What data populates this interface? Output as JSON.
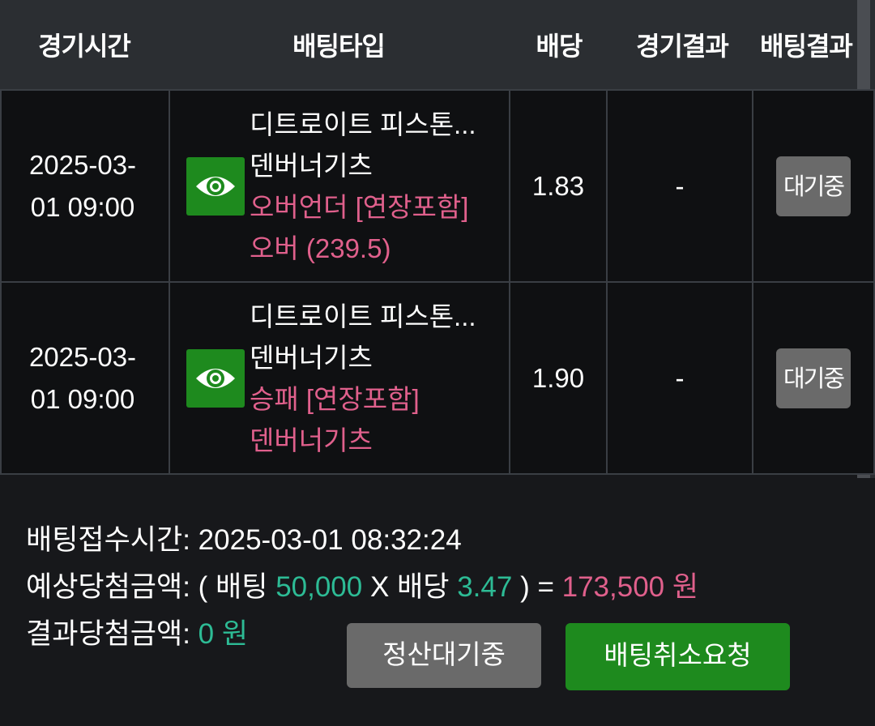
{
  "header": {
    "columns": [
      "경기시간",
      "배팅타입",
      "배당",
      "경기결과",
      "배팅결과"
    ]
  },
  "bets": [
    {
      "time_line1": "2025-03-",
      "time_line2": "01 09:00",
      "icon": "eye-icon",
      "match_home": "디트로이트 피스톤...",
      "match_away": "덴버너기츠",
      "market": "오버언더 [연장포함]",
      "pick": "오버 (239.5)",
      "odds": "1.83",
      "result": "-",
      "status": "대기중"
    },
    {
      "time_line1": "2025-03-",
      "time_line2": "01 09:00",
      "icon": "eye-icon",
      "match_home": "디트로이트 피스톤...",
      "match_away": "덴버너기츠",
      "market": "승패 [연장포함]",
      "pick": "덴버너기츠",
      "odds": "1.90",
      "result": "-",
      "status": "대기중"
    }
  ],
  "summary": {
    "received_label": "배팅접수시간:",
    "received_value": "2025-03-01 08:32:24",
    "expected_label": "예상당첨금액:",
    "expected_open": "( 배팅",
    "stake": "50,000",
    "x_label": "X 배당",
    "total_odds": "3.47",
    "expected_close": ") =",
    "expected_amount": "173,500 원",
    "result_label": "결과당첨금액:",
    "result_amount": "0 원"
  },
  "buttons": {
    "settle": "정산대기중",
    "cancel": "배팅취소요청"
  },
  "colors": {
    "accent_green": "#1e8a1e",
    "pink": "#e0608c",
    "teal": "#2dbb95",
    "gray_button": "#6a6a6a"
  }
}
